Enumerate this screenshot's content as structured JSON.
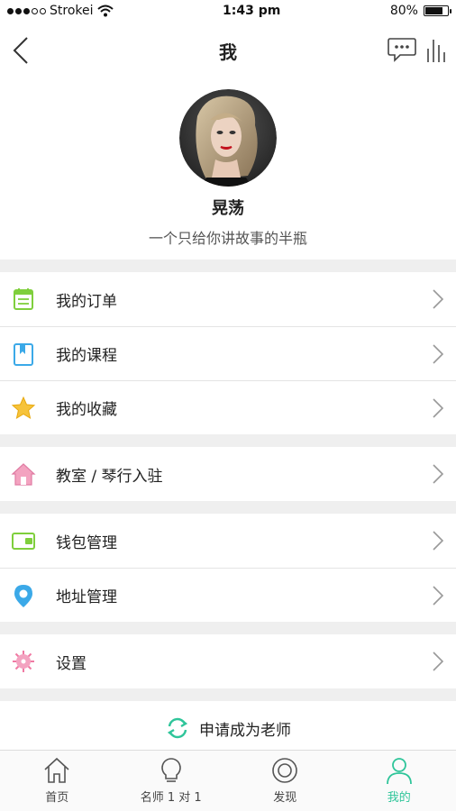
{
  "status_bar": {
    "carrier": "Strokei",
    "time": "1:43 pm",
    "battery": "80%",
    "battery_level": 0.8
  },
  "nav": {
    "title": "我",
    "back_icon": "chevron-left-icon",
    "message_icon": "chat-bubble-icon",
    "stats_icon": "bars-icon"
  },
  "profile": {
    "name": "晃荡",
    "bio": "一个只给你讲故事的半瓶"
  },
  "menu": {
    "orders": "我的订单",
    "courses": "我的课程",
    "favorites": "我的收藏",
    "studio": "教室 / 琴行入驻",
    "wallet": "钱包管理",
    "address": "地址管理",
    "settings": "设置"
  },
  "apply": {
    "label": "申请成为老师"
  },
  "tabs": [
    {
      "label": "首页",
      "icon": "home-icon",
      "active": false
    },
    {
      "label": "名师 1 对 1",
      "icon": "lightbulb-icon",
      "active": false
    },
    {
      "label": "发现",
      "icon": "target-icon",
      "active": false
    },
    {
      "label": "我的",
      "icon": "person-icon",
      "active": true
    }
  ],
  "colors": {
    "accent": "#2fc59a",
    "divider": "#efefef"
  }
}
